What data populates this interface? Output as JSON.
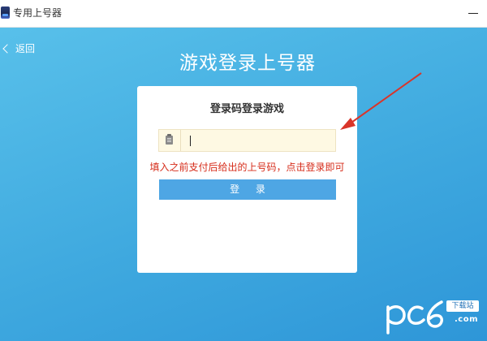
{
  "window": {
    "title": "专用上号器",
    "icon": "app-icon",
    "minimize_icon": "minimize-icon"
  },
  "nav": {
    "back_label": "返回",
    "back_icon": "chevron-left-icon"
  },
  "main": {
    "title": "游戏登录上号器"
  },
  "login_card": {
    "title": "登录码登录游戏",
    "code_field": {
      "icon": "clipboard-icon",
      "value": "",
      "placeholder": ""
    },
    "hint": "填入之前支付后给出的上号码，点击登录即可",
    "button_label": "登 录"
  },
  "annotation": {
    "type": "red-arrow",
    "color": "#d9352a"
  },
  "watermark": {
    "logo_text": "pc6",
    "badge_text": "下载站",
    "domain": ".com"
  },
  "colors": {
    "background_top": "#58c0ea",
    "background_bottom": "#2e96d8",
    "button": "#4ea6e4",
    "hint": "#d62c1a",
    "field_bg": "#fef9e3"
  }
}
